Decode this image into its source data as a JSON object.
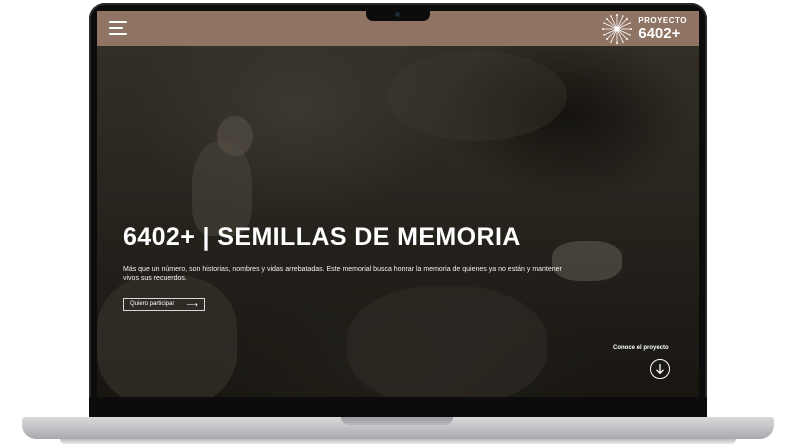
{
  "header": {
    "menu_icon": "hamburger-menu-icon",
    "logo_icon": "dandelion-seed-icon",
    "logo_small": "PROYECTO",
    "logo_big": "6402+"
  },
  "hero": {
    "title": "6402+ | SEMILLAS DE MEMORIA",
    "description": "Más que un número, son historias, nombres y vidas arrebatadas. Este memorial busca honrar la memoria de quienes ya no están y mantener vivos sus recuerdos.",
    "cta_label": "Quiero participar",
    "cta_icon": "arrow-right-icon",
    "scroll_label": "Conoce el proyecto",
    "scroll_icon": "arrow-down-circle-icon"
  },
  "colors": {
    "header_bg": "#8f7363",
    "text": "#ffffff"
  }
}
